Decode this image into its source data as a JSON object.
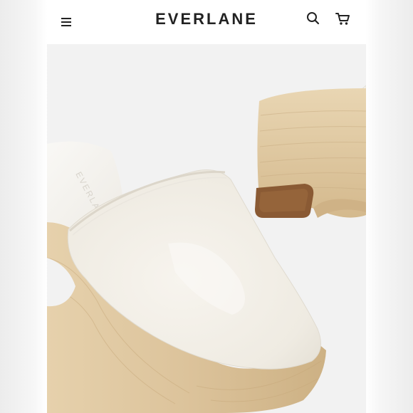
{
  "header": {
    "brand": "EVERLANE",
    "menu_icon": "hamburger-menu-icon",
    "search_icon": "search-icon",
    "cart_icon": "shopping-cart-icon"
  },
  "product_image": {
    "subject": "clog-mule-photo",
    "embossed_text": "EVERLANE"
  },
  "colors": {
    "background": "#f2f2f2",
    "leather": "#f1ede4",
    "wood": "#dcc39b",
    "heel_pad": "#8a5a34",
    "text": "#222222"
  }
}
